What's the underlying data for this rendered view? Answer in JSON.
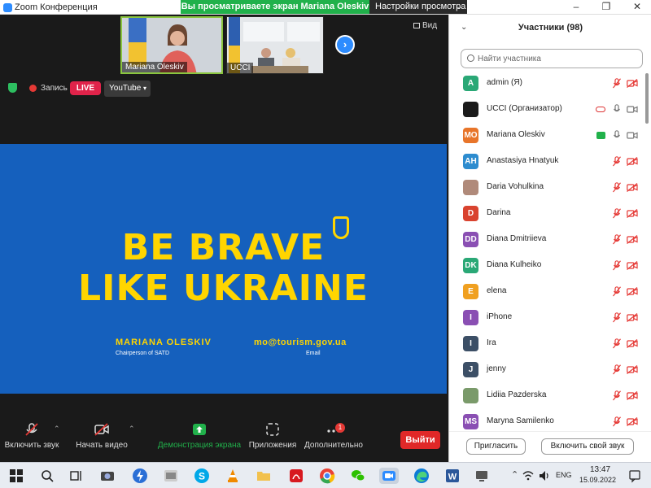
{
  "window": {
    "title": "Zoom Конференция",
    "share_banner": "Вы просматриваете экран Mariana Oleskiv",
    "view_settings": "Настройки просмотра"
  },
  "gallery": {
    "thumbs": [
      {
        "name": "Mariana Oleskiv"
      },
      {
        "name": "UCCI"
      }
    ],
    "view_label": "Вид"
  },
  "status": {
    "record_label": "Запись",
    "live_label": "LIVE",
    "stream_label": "YouTube"
  },
  "slide": {
    "line1": "BE BRAVE",
    "line2": "LIKE UKRAINE",
    "presenter_name": "MARIANA OLESKIV",
    "presenter_role": "Chairperson of SATD",
    "email": "mo@tourism.gov.ua",
    "email_label": "Email"
  },
  "toolbar": {
    "mute_label": "Включить звук",
    "video_label": "Начать видео",
    "share_label": "Демонстрация экрана",
    "apps_label": "Приложения",
    "more_label": "Дополнительно",
    "more_badge": "1",
    "leave_label": "Выйти"
  },
  "panel": {
    "title": "Участники (98)",
    "search_placeholder": "Найти участника",
    "participants": [
      {
        "name": "admin (Я)",
        "initials": "A",
        "color": "#2aa876",
        "status": "muted"
      },
      {
        "name": "UCCI (Организатор)",
        "initials": "",
        "color": "#1a1a1a",
        "status": "host"
      },
      {
        "name": "Mariana Oleskiv",
        "initials": "MO",
        "color": "#e8752a",
        "status": "sharing"
      },
      {
        "name": "Anastasiya Hnatyuk",
        "initials": "AH",
        "color": "#2d8ccf",
        "status": "muted"
      },
      {
        "name": "Daria Vohulkina",
        "initials": "",
        "color": "#b08a7a",
        "status": "muted"
      },
      {
        "name": "Darina",
        "initials": "D",
        "color": "#d9432f",
        "status": "muted"
      },
      {
        "name": "Diana Dmitriieva",
        "initials": "DD",
        "color": "#8a4fb3",
        "status": "muted"
      },
      {
        "name": "Diana Kulheiko",
        "initials": "DK",
        "color": "#2aa876",
        "status": "muted"
      },
      {
        "name": "elena",
        "initials": "E",
        "color": "#f0a020",
        "status": "muted"
      },
      {
        "name": "iPhone",
        "initials": "I",
        "color": "#8a4fb3",
        "status": "muted"
      },
      {
        "name": "Ira",
        "initials": "I",
        "color": "#3c4f66",
        "status": "muted"
      },
      {
        "name": "jenny",
        "initials": "J",
        "color": "#3c4f66",
        "status": "muted"
      },
      {
        "name": "Lidiia Pazderska",
        "initials": "",
        "color": "#7a9a6a",
        "status": "muted"
      },
      {
        "name": "Maryna Samilenko",
        "initials": "MS",
        "color": "#8a4fb3",
        "status": "muted"
      }
    ],
    "invite_label": "Пригласить",
    "unmute_self_label": "Включить свой звук"
  },
  "taskbar": {
    "lang": "ENG",
    "time": "13:47",
    "date": "15.09.2022"
  }
}
